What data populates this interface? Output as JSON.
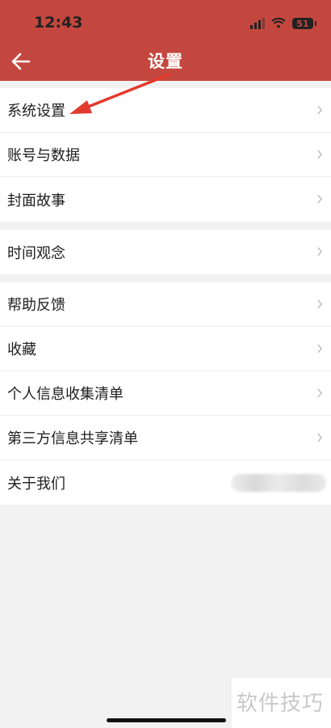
{
  "status_bar": {
    "time": "12:43",
    "battery": "51"
  },
  "header": {
    "title": "设置"
  },
  "groups": [
    {
      "items": [
        {
          "label": "系统设置"
        },
        {
          "label": "账号与数据"
        },
        {
          "label": "封面故事"
        }
      ]
    },
    {
      "items": [
        {
          "label": "时间观念"
        }
      ]
    },
    {
      "items": [
        {
          "label": "帮助反馈"
        },
        {
          "label": "收藏"
        },
        {
          "label": "个人信息收集清单"
        },
        {
          "label": "第三方信息共享清单"
        },
        {
          "label": "关于我们"
        }
      ]
    }
  ],
  "watermark": "软件技巧",
  "colors": {
    "header": "#c4473f",
    "annotation_arrow": "#e23a2e"
  }
}
